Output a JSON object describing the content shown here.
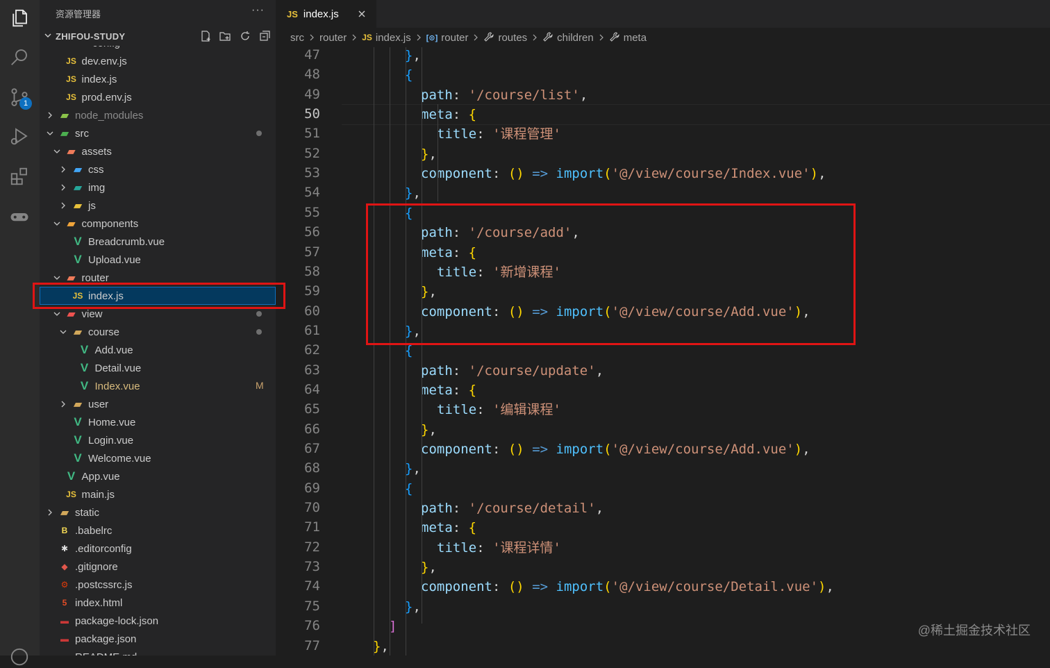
{
  "sidebar": {
    "title": "资源管理器",
    "more": "···",
    "workspace": "ZHIFOU-STUDY",
    "partial_top": "config",
    "items": [
      {
        "label": "dev.env.js",
        "icon": "js-file-icon",
        "depth": 2,
        "chevron": ""
      },
      {
        "label": "index.js",
        "icon": "js-file-icon",
        "depth": 2,
        "chevron": ""
      },
      {
        "label": "prod.env.js",
        "icon": "js-file-icon",
        "depth": 2,
        "chevron": ""
      },
      {
        "label": "node_modules",
        "icon": "node-folder-icon",
        "depth": 1,
        "chevron": "right",
        "dim": true
      },
      {
        "label": "src",
        "icon": "src-folder-icon",
        "depth": 1,
        "chevron": "down",
        "dot": true
      },
      {
        "label": "assets",
        "icon": "assets-folder-icon",
        "depth": 2,
        "chevron": "down"
      },
      {
        "label": "css",
        "icon": "css-folder-icon",
        "depth": 3,
        "chevron": "right"
      },
      {
        "label": "img",
        "icon": "img-folder-icon",
        "depth": 3,
        "chevron": "right"
      },
      {
        "label": "js",
        "icon": "js-folder-icon",
        "depth": 3,
        "chevron": "right"
      },
      {
        "label": "components",
        "icon": "components-folder-icon",
        "depth": 2,
        "chevron": "down"
      },
      {
        "label": "Breadcrumb.vue",
        "icon": "vue-file-icon",
        "depth": 3,
        "chevron": ""
      },
      {
        "label": "Upload.vue",
        "icon": "vue-file-icon",
        "depth": 3,
        "chevron": ""
      },
      {
        "label": "router",
        "icon": "router-folder-icon",
        "depth": 2,
        "chevron": "down"
      },
      {
        "label": "index.js",
        "icon": "js-file-icon",
        "depth": 3,
        "chevron": "",
        "selected": true
      },
      {
        "label": "view",
        "icon": "view-folder-icon",
        "depth": 2,
        "chevron": "down",
        "dot": true
      },
      {
        "label": "course",
        "icon": "folder-icon",
        "depth": 3,
        "chevron": "down",
        "dot": true
      },
      {
        "label": "Add.vue",
        "icon": "vue-file-icon",
        "depth": 4,
        "chevron": ""
      },
      {
        "label": "Detail.vue",
        "icon": "vue-file-icon",
        "depth": 4,
        "chevron": ""
      },
      {
        "label": "Index.vue",
        "icon": "vue-file-icon",
        "depth": 4,
        "chevron": "",
        "modified": true,
        "mark": "M"
      },
      {
        "label": "user",
        "icon": "folder-icon",
        "depth": 3,
        "chevron": "right"
      },
      {
        "label": "Home.vue",
        "icon": "vue-file-icon",
        "depth": 3,
        "chevron": ""
      },
      {
        "label": "Login.vue",
        "icon": "vue-file-icon",
        "depth": 3,
        "chevron": ""
      },
      {
        "label": "Welcome.vue",
        "icon": "vue-file-icon",
        "depth": 3,
        "chevron": ""
      },
      {
        "label": "App.vue",
        "icon": "vue-file-icon",
        "depth": 2,
        "chevron": ""
      },
      {
        "label": "main.js",
        "icon": "js-file-icon",
        "depth": 2,
        "chevron": ""
      },
      {
        "label": "static",
        "icon": "static-folder-icon",
        "depth": 1,
        "chevron": "right"
      },
      {
        "label": ".babelrc",
        "icon": "babel-file-icon",
        "depth": 1,
        "chevron": ""
      },
      {
        "label": ".editorconfig",
        "icon": "editorconfig-file-icon",
        "depth": 1,
        "chevron": ""
      },
      {
        "label": ".gitignore",
        "icon": "git-file-icon",
        "depth": 1,
        "chevron": ""
      },
      {
        "label": ".postcssrc.js",
        "icon": "postcss-file-icon",
        "depth": 1,
        "chevron": ""
      },
      {
        "label": "index.html",
        "icon": "html-file-icon",
        "depth": 1,
        "chevron": ""
      },
      {
        "label": "package-lock.json",
        "icon": "npm-file-icon",
        "depth": 1,
        "chevron": ""
      },
      {
        "label": "package.json",
        "icon": "npm-file-icon",
        "depth": 1,
        "chevron": ""
      },
      {
        "label": "README.md",
        "icon": "readme-file-icon",
        "depth": 1,
        "chevron": ""
      }
    ]
  },
  "activity": {
    "scm_badge": "1"
  },
  "tab": {
    "badge": "JS",
    "label": "index.js"
  },
  "breadcrumb": [
    {
      "label": "src",
      "icon": ""
    },
    {
      "label": "router",
      "icon": ""
    },
    {
      "label": "index.js",
      "icon": "JS"
    },
    {
      "label": "router",
      "icon": "[⊙]"
    },
    {
      "label": "routes",
      "icon": "wrench"
    },
    {
      "label": "children",
      "icon": "wrench"
    },
    {
      "label": "meta",
      "icon": "wrench"
    }
  ],
  "editor": {
    "current_line": "50",
    "lines": [
      {
        "n": "47",
        "indent": 4,
        "tokens": [
          [
            "b2",
            "}"
          ],
          [
            "p",
            ","
          ]
        ]
      },
      {
        "n": "48",
        "indent": 4,
        "tokens": [
          [
            "b2",
            "{"
          ]
        ]
      },
      {
        "n": "49",
        "indent": 5,
        "tokens": [
          [
            "k",
            "path"
          ],
          [
            "p",
            ": "
          ],
          [
            "s",
            "'/course/list'"
          ],
          [
            "p",
            ","
          ]
        ]
      },
      {
        "n": "50",
        "indent": 5,
        "tokens": [
          [
            "k",
            "meta"
          ],
          [
            "p",
            ": "
          ],
          [
            "b3",
            "{"
          ]
        ]
      },
      {
        "n": "51",
        "indent": 6,
        "tokens": [
          [
            "k",
            "title"
          ],
          [
            "p",
            ": "
          ],
          [
            "s",
            "'课程管理'"
          ]
        ]
      },
      {
        "n": "52",
        "indent": 5,
        "tokens": [
          [
            "b3",
            "}"
          ],
          [
            "p",
            ","
          ]
        ]
      },
      {
        "n": "53",
        "indent": 5,
        "tokens": [
          [
            "k",
            "component"
          ],
          [
            "p",
            ": "
          ],
          [
            "b3",
            "()"
          ],
          [
            "p",
            " "
          ],
          [
            "kw",
            "=>"
          ],
          [
            "p",
            " "
          ],
          [
            "fn",
            "import"
          ],
          [
            "b3",
            "("
          ],
          [
            "s",
            "'@/view/course/Index.vue'"
          ],
          [
            "b3",
            ")"
          ],
          [
            "p",
            ","
          ]
        ]
      },
      {
        "n": "54",
        "indent": 4,
        "tokens": [
          [
            "b2",
            "}"
          ],
          [
            "p",
            ","
          ]
        ]
      },
      {
        "n": "55",
        "indent": 4,
        "tokens": [
          [
            "b2",
            "{"
          ]
        ]
      },
      {
        "n": "56",
        "indent": 5,
        "tokens": [
          [
            "k",
            "path"
          ],
          [
            "p",
            ": "
          ],
          [
            "s",
            "'/course/add'"
          ],
          [
            "p",
            ","
          ]
        ]
      },
      {
        "n": "57",
        "indent": 5,
        "tokens": [
          [
            "k",
            "meta"
          ],
          [
            "p",
            ": "
          ],
          [
            "b3",
            "{"
          ]
        ]
      },
      {
        "n": "58",
        "indent": 6,
        "tokens": [
          [
            "k",
            "title"
          ],
          [
            "p",
            ": "
          ],
          [
            "s",
            "'新增课程'"
          ]
        ]
      },
      {
        "n": "59",
        "indent": 5,
        "tokens": [
          [
            "b3",
            "}"
          ],
          [
            "p",
            ","
          ]
        ]
      },
      {
        "n": "60",
        "indent": 5,
        "tokens": [
          [
            "k",
            "component"
          ],
          [
            "p",
            ": "
          ],
          [
            "b3",
            "()"
          ],
          [
            "p",
            " "
          ],
          [
            "kw",
            "=>"
          ],
          [
            "p",
            " "
          ],
          [
            "fn",
            "import"
          ],
          [
            "b3",
            "("
          ],
          [
            "s",
            "'@/view/course/Add.vue'"
          ],
          [
            "b3",
            ")"
          ],
          [
            "p",
            ","
          ]
        ]
      },
      {
        "n": "61",
        "indent": 4,
        "tokens": [
          [
            "b2",
            "}"
          ],
          [
            "p",
            ","
          ]
        ]
      },
      {
        "n": "62",
        "indent": 4,
        "tokens": [
          [
            "b2",
            "{"
          ]
        ]
      },
      {
        "n": "63",
        "indent": 5,
        "tokens": [
          [
            "k",
            "path"
          ],
          [
            "p",
            ": "
          ],
          [
            "s",
            "'/course/update'"
          ],
          [
            "p",
            ","
          ]
        ]
      },
      {
        "n": "64",
        "indent": 5,
        "tokens": [
          [
            "k",
            "meta"
          ],
          [
            "p",
            ": "
          ],
          [
            "b3",
            "{"
          ]
        ]
      },
      {
        "n": "65",
        "indent": 6,
        "tokens": [
          [
            "k",
            "title"
          ],
          [
            "p",
            ": "
          ],
          [
            "s",
            "'编辑课程'"
          ]
        ]
      },
      {
        "n": "66",
        "indent": 5,
        "tokens": [
          [
            "b3",
            "}"
          ],
          [
            "p",
            ","
          ]
        ]
      },
      {
        "n": "67",
        "indent": 5,
        "tokens": [
          [
            "k",
            "component"
          ],
          [
            "p",
            ": "
          ],
          [
            "b3",
            "()"
          ],
          [
            "p",
            " "
          ],
          [
            "kw",
            "=>"
          ],
          [
            "p",
            " "
          ],
          [
            "fn",
            "import"
          ],
          [
            "b3",
            "("
          ],
          [
            "s",
            "'@/view/course/Add.vue'"
          ],
          [
            "b3",
            ")"
          ],
          [
            "p",
            ","
          ]
        ]
      },
      {
        "n": "68",
        "indent": 4,
        "tokens": [
          [
            "b2",
            "}"
          ],
          [
            "p",
            ","
          ]
        ]
      },
      {
        "n": "69",
        "indent": 4,
        "tokens": [
          [
            "b2",
            "{"
          ]
        ]
      },
      {
        "n": "70",
        "indent": 5,
        "tokens": [
          [
            "k",
            "path"
          ],
          [
            "p",
            ": "
          ],
          [
            "s",
            "'/course/detail'"
          ],
          [
            "p",
            ","
          ]
        ]
      },
      {
        "n": "71",
        "indent": 5,
        "tokens": [
          [
            "k",
            "meta"
          ],
          [
            "p",
            ": "
          ],
          [
            "b3",
            "{"
          ]
        ]
      },
      {
        "n": "72",
        "indent": 6,
        "tokens": [
          [
            "k",
            "title"
          ],
          [
            "p",
            ": "
          ],
          [
            "s",
            "'课程详情'"
          ]
        ]
      },
      {
        "n": "73",
        "indent": 5,
        "tokens": [
          [
            "b3",
            "}"
          ],
          [
            "p",
            ","
          ]
        ]
      },
      {
        "n": "74",
        "indent": 5,
        "tokens": [
          [
            "k",
            "component"
          ],
          [
            "p",
            ": "
          ],
          [
            "b3",
            "()"
          ],
          [
            "p",
            " "
          ],
          [
            "kw",
            "=>"
          ],
          [
            "p",
            " "
          ],
          [
            "fn",
            "import"
          ],
          [
            "b3",
            "("
          ],
          [
            "s",
            "'@/view/course/Detail.vue'"
          ],
          [
            "b3",
            ")"
          ],
          [
            "p",
            ","
          ]
        ]
      },
      {
        "n": "75",
        "indent": 4,
        "tokens": [
          [
            "b2",
            "}"
          ],
          [
            "p",
            ","
          ]
        ]
      },
      {
        "n": "76",
        "indent": 3,
        "tokens": [
          [
            "b1",
            "]"
          ]
        ]
      },
      {
        "n": "77",
        "indent": 2,
        "tokens": [
          [
            "b3",
            "}"
          ],
          [
            "p",
            ","
          ]
        ]
      }
    ]
  },
  "watermark": "@稀土掘金技术社区",
  "colors": {
    "accent": "#0e70c0",
    "highlight": "#e01414",
    "modified": "#d7ba7d"
  }
}
